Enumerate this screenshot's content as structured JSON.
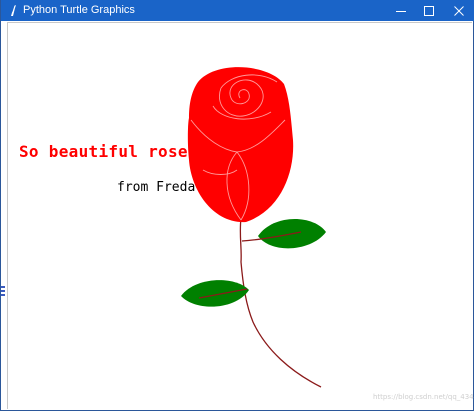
{
  "window": {
    "title": "Python Turtle Graphics",
    "titlebar_color": "#1a64c8",
    "controls": {
      "minimize_icon": "minimize-icon",
      "maximize_icon": "maximize-icon",
      "close_icon": "close-icon"
    }
  },
  "canvas": {
    "background": "#ffffff",
    "caption_main": "So beautiful rose!",
    "caption_main_color": "#ff0000",
    "caption_sub": "from Freda",
    "caption_sub_color": "#000000",
    "watermark": "https://blog.csdn.net/qq_43402021"
  },
  "rose": {
    "petal_color": "#ff0000",
    "outline_color": "#ff9999",
    "stem_color": "#8b1a1a",
    "leaf_color": "#008000"
  }
}
